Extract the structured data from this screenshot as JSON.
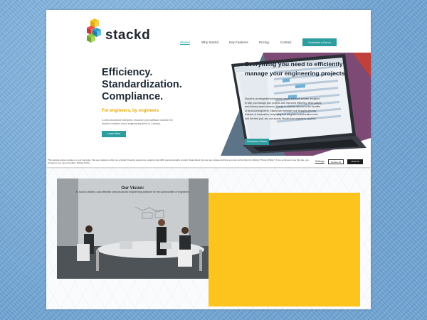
{
  "brand": {
    "name": "stackd"
  },
  "nav": {
    "items": [
      {
        "label": "Stackd"
      },
      {
        "label": "Why Stackd"
      },
      {
        "label": "Key Features"
      },
      {
        "label": "Pricing"
      },
      {
        "label": "Contact"
      }
    ],
    "cta_label": "Schedule a Demo"
  },
  "hero": {
    "headline_1": "Efficiency.",
    "headline_2": "Standardization.",
    "headline_3": "Compliance.",
    "subheading": "For engineers, by engineers",
    "description": "A web-structured enterprise resource plan software solution for small to medium-sized engineering firms in Canada.",
    "cta_label": "Learn More"
  },
  "cookie": {
    "text": "This website stores cookies on your computer. We use cookies to offer you a better browsing experience, analyze site traffic and personalize content. Read about how we use cookies and how you can control them by clicking \"Privacy Policy\". If you continue to use this site, you consent to our use of cookies. Privacy Policy",
    "settings_label": "Settings",
    "decline_label": "Decline All",
    "allow_label": "Allow All"
  },
  "vision": {
    "title": "Our Vision:",
    "text": "To build a reliable, cost-effective web-structured engineering software for the communities of engineers."
  },
  "feature": {
    "title": "Everything you need to efficiently manage your engineering projects.",
    "description": "Stackd is an integrated subscription-based software solution designed to help you manage your projects with improved efficiency, effort saving, and industry-based revenue. Stackd is modular, tailored to the benefits of structural engineers. Stackd can translate your thoughts into key features of automation, templating and integrated collaboration tools. And the best part, you can access Stackd from anywhere, anytime.",
    "cta_label": "Schedule a Demo"
  },
  "colors": {
    "teal": "#2d9ea0",
    "yellow": "#fcc41d",
    "purple": "#7c4a74",
    "slate": "#5d7388",
    "headline": "#1e2a36",
    "gold_text": "#e9a800"
  }
}
